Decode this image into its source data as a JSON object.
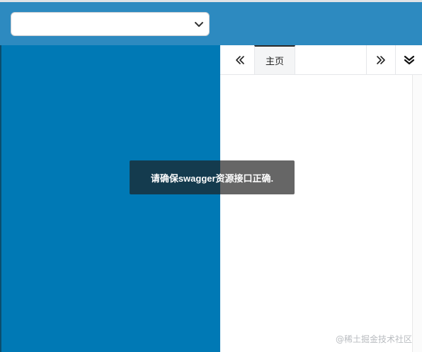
{
  "header": {
    "select": {
      "value": ""
    }
  },
  "tabs": {
    "home_label": "主页"
  },
  "toast": {
    "message": "请确保swagger资源接口正确."
  },
  "watermark": {
    "text": "@稀土掘金技术社区"
  },
  "icons": {
    "select_chevron": "chevron-down-icon",
    "scroll_left": "double-chevron-left-icon",
    "scroll_right": "double-chevron-right-icon",
    "tab_menu": "double-chevron-down-icon"
  },
  "colors": {
    "header_bg": "#2d8ac0",
    "sidebar_bg": "#0079b5",
    "toast_bg": "rgba(30,30,30,0.68)"
  }
}
